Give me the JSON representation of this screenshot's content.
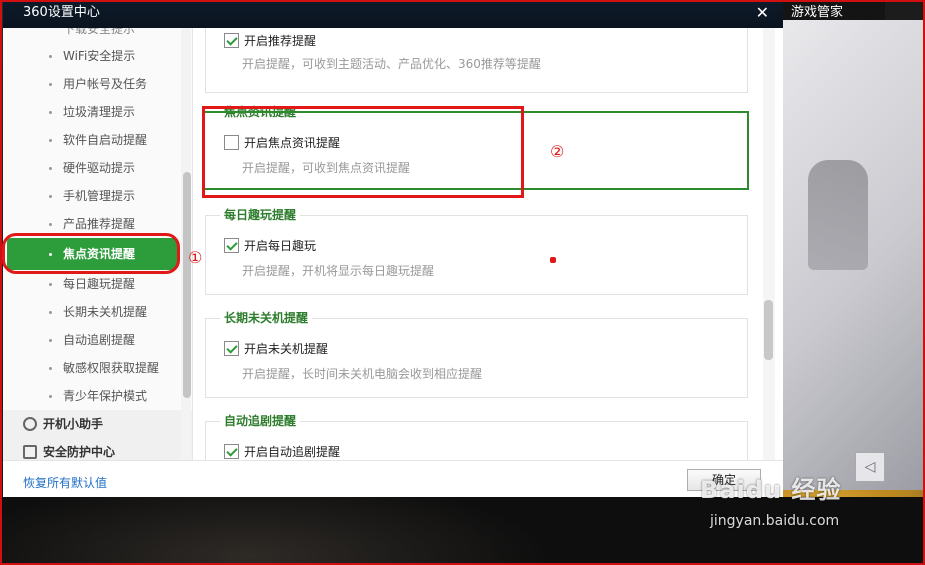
{
  "window": {
    "title": "360设置中心",
    "close_label": "✕"
  },
  "background": {
    "right_top_text": "游戏管家",
    "collapse_label": "◁"
  },
  "sidebar": {
    "partial_top": "下载安全提示",
    "items": [
      {
        "label": "WiFi安全提示"
      },
      {
        "label": "用户帐号及任务"
      },
      {
        "label": "垃圾清理提示"
      },
      {
        "label": "软件自启动提醒"
      },
      {
        "label": "硬件驱动提示"
      },
      {
        "label": "手机管理提示"
      },
      {
        "label": "产品推荐提醒"
      },
      {
        "label": "焦点资讯提醒",
        "active": true
      },
      {
        "label": "每日趣玩提醒"
      },
      {
        "label": "长期未关机提醒"
      },
      {
        "label": "自动追剧提醒"
      },
      {
        "label": "敏感权限获取提醒"
      },
      {
        "label": "青少年保护模式"
      }
    ],
    "categories": [
      {
        "label": "开机小助手",
        "icon": "clock-icon"
      },
      {
        "label": "安全防护中心",
        "icon": "shield-grid-icon"
      }
    ]
  },
  "content": {
    "sections": [
      {
        "title": "",
        "checkbox_label": "开启推荐提醒",
        "checked": true,
        "description": "开启提醒，可收到主题活动、产品优化、360推荐等提醒"
      },
      {
        "title": "焦点资讯提醒",
        "checkbox_label": "开启焦点资讯提醒",
        "checked": false,
        "description": "开启提醒，可收到焦点资讯提醒"
      },
      {
        "title": "每日趣玩提醒",
        "checkbox_label": "开启每日趣玩",
        "checked": true,
        "description": "开启提醒，开机将显示每日趣玩提醒"
      },
      {
        "title": "长期未关机提醒",
        "checkbox_label": "开启未关机提醒",
        "checked": true,
        "description": "开启提醒，长时间未关机电脑会收到相应提醒"
      },
      {
        "title": "自动追剧提醒",
        "checkbox_label": "开启自动追剧提醒",
        "checked": true,
        "description": ""
      }
    ]
  },
  "footer": {
    "reset_label": "恢复所有默认值",
    "ok_label": "确定"
  },
  "annotations": {
    "marker_1": "①",
    "marker_2": "②"
  },
  "watermark": {
    "main": "Baidu 经验",
    "sub": "jingyan.baidu.com"
  },
  "colors": {
    "accent_green": "#2d9c3b",
    "section_title_green": "#2d7d2d",
    "annotation_red": "#e01818",
    "link_blue": "#1f6fc5",
    "titlebar": "#0e1a2a"
  }
}
